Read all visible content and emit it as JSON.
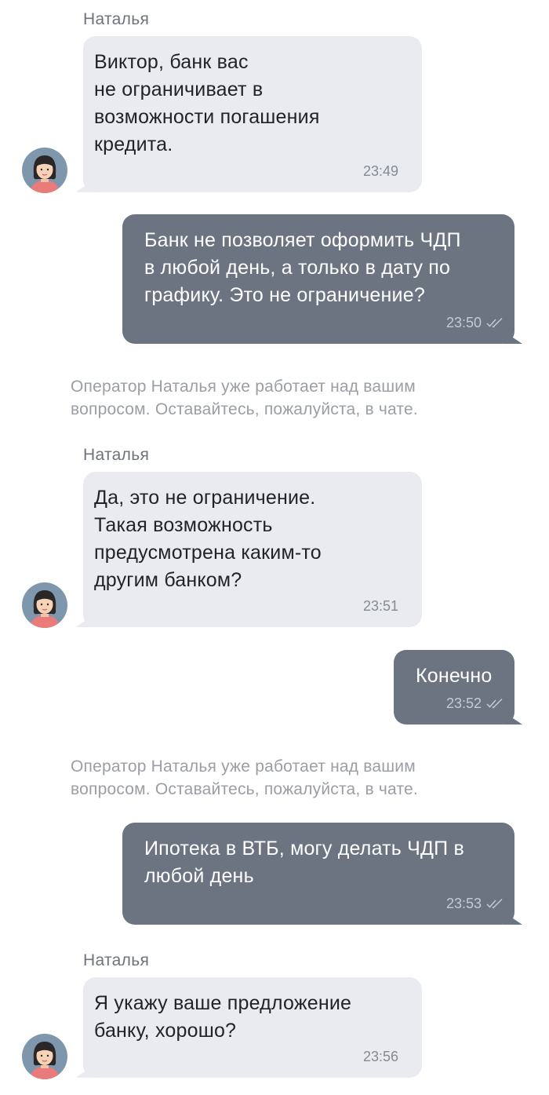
{
  "colors": {
    "incoming_bubble": "#e9ebf0",
    "outgoing_bubble": "#6b7480",
    "avatar_bg": "#7f97ac",
    "avatar_shirt": "#ea7b7b",
    "system_text": "#9a9ea5"
  },
  "messages": [
    {
      "sender": "Наталья",
      "text": "Виктор, банк вас\nне ограничивает в\nвозможности погашения\nкредита.",
      "time": "23:49"
    },
    {
      "text": "Банк не позволяет оформить ЧДП\nв любой день, а только в дату по\nграфику. Это не ограничение?",
      "time": "23:50",
      "status_icon": "double-check-icon"
    },
    {
      "system": "Оператор Наталья уже работает над вашим\nвопросом. Оставайтесь, пожалуйста, в чате."
    },
    {
      "sender": "Наталья",
      "text": "Да, это не ограничение.\nТакая возможность\nпредусмотрена каким-то\nдругим банком?",
      "time": "23:51"
    },
    {
      "text": "Конечно",
      "time": "23:52",
      "status_icon": "double-check-icon"
    },
    {
      "system": "Оператор Наталья уже работает над вашим\nвопросом. Оставайтесь, пожалуйста, в чате."
    },
    {
      "text": "Ипотека в ВТБ, могу делать ЧДП в\nлюбой день",
      "time": "23:53",
      "status_icon": "double-check-icon"
    },
    {
      "sender": "Наталья",
      "text": "Я укажу ваше предложение\nбанку, хорошо?",
      "time": "23:56"
    }
  ]
}
